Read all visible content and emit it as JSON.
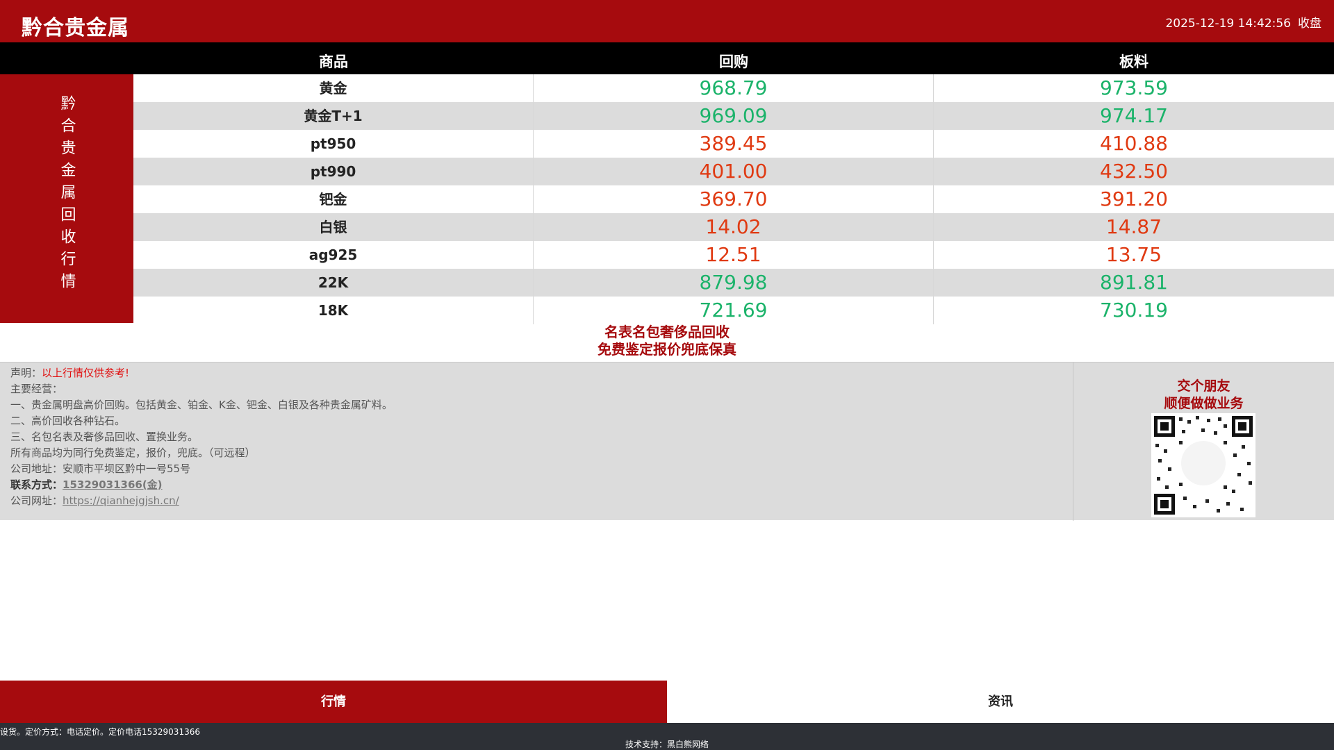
{
  "header": {
    "brand": "黔合贵金属",
    "datetime": "2025-12-19 14:42:56",
    "market_status": "收盘"
  },
  "table": {
    "columns": [
      "商品",
      "回购",
      "板料"
    ],
    "side_label": "黔合贵金属回收行情",
    "rows": [
      {
        "name": "黄金",
        "buy": "968.79",
        "sell": "973.59",
        "color": "green"
      },
      {
        "name": "黄金T+1",
        "buy": "969.09",
        "sell": "974.17",
        "color": "green"
      },
      {
        "name": "pt950",
        "buy": "389.45",
        "sell": "410.88",
        "color": "red"
      },
      {
        "name": "pt990",
        "buy": "401.00",
        "sell": "432.50",
        "color": "red"
      },
      {
        "name": "钯金",
        "buy": "369.70",
        "sell": "391.20",
        "color": "red"
      },
      {
        "name": "白银",
        "buy": "14.02",
        "sell": "14.87",
        "color": "red"
      },
      {
        "name": "ag925",
        "buy": "12.51",
        "sell": "13.75",
        "color": "red"
      },
      {
        "name": "22K",
        "buy": "879.98",
        "sell": "891.81",
        "color": "green"
      },
      {
        "name": "18K",
        "buy": "721.69",
        "sell": "730.19",
        "color": "green"
      }
    ]
  },
  "promo": {
    "line1": "名表名包奢侈品回收",
    "line2": "免费鉴定报价兜底保真"
  },
  "info": {
    "disclaimer_label": "声明：",
    "disclaimer_text": "以上行情仅供参考!",
    "business_label": "主要经营：",
    "item1": "一、贵金属明盘高价回购。包括黄金、铂金、K金、钯金、白银及各种贵金属矿料。",
    "item2": "二、高价回收各种钻石。",
    "item3": "三、名包名表及奢侈品回收、置换业务。",
    "item4": "所有商品均为同行免费鉴定，报价，兜底。（可远程）",
    "address": "公司地址：安顺市平坝区黔中一号55号",
    "contact_label": "联系方式：",
    "contact_value": "15329031366(金)",
    "website_label": "公司网址：",
    "website_value": "https://qianhejgjsh.cn/"
  },
  "qr_panel": {
    "line1": "交个朋友",
    "line2": "顺便做做业务"
  },
  "tabs": {
    "quotes": "行情",
    "news": "资讯"
  },
  "footer": {
    "ticker": "设货。定价方式：电话定价。定价电话15329031366",
    "credit": "技术支持：黑白熊网络"
  },
  "colors": {
    "brand_red": "#a60b0e",
    "price_green": "#1bb36a",
    "price_red": "#e03a12"
  }
}
